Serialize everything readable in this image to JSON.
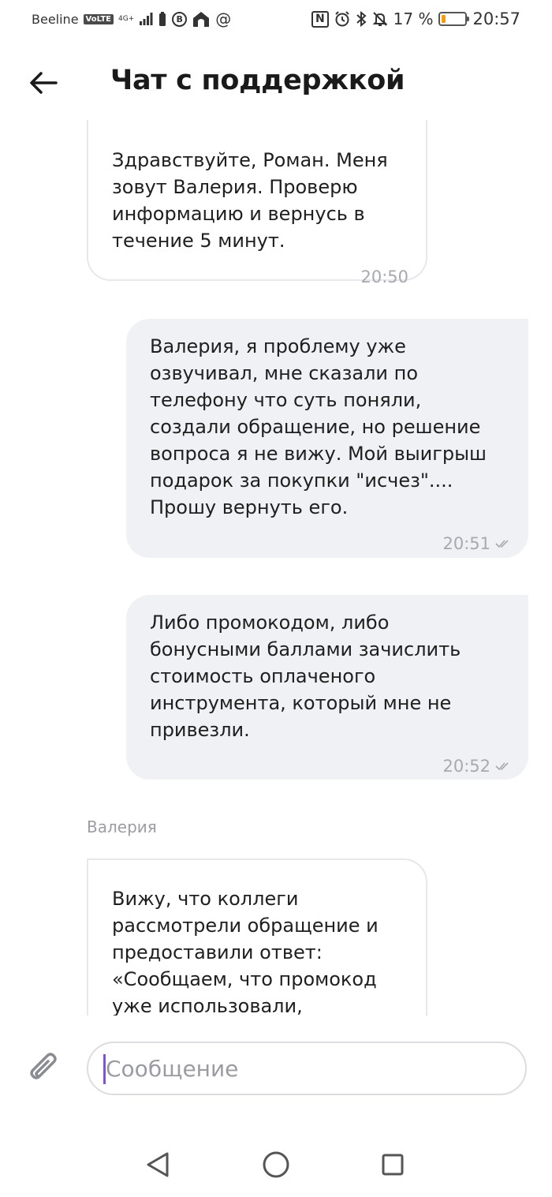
{
  "status_bar": {
    "carrier": "Beeline",
    "volte": "VoLTE",
    "network": "4G+",
    "vk_badge": "В",
    "at_sign": "@",
    "nfc": "N",
    "battery_percent_text": "17 %",
    "battery_level": 0.17,
    "battery_color": "#f39c12",
    "time": "20:57"
  },
  "header": {
    "title": "Чат с поддержкой"
  },
  "messages": [
    {
      "direction": "incoming",
      "text": "Здравствуйте, Роман. Меня\nзовут Валерия. Проверю\nинформацию и вернусь в\nтечение 5 минут.",
      "time": "20:50"
    },
    {
      "direction": "outgoing",
      "text": "Валерия, я проблему уже\nозвучивал, мне сказали по\nтелефону что суть поняли,\nсоздали обращение, но решение\nвопроса я не вижу. Мой выигрыш\nподарок за покупки \"исчез\"....\nПрошу вернуть его.",
      "time": "20:51"
    },
    {
      "direction": "outgoing",
      "text": "Либо промокодом, либо\nбонусными баллами зачислить\nстоимость оплаченого\nинструмента, который мне не\nпривезли.",
      "time": "20:52"
    },
    {
      "direction": "incoming",
      "sender": "Валерия",
      "text": "Вижу, что коллеги\nрассмотрели обращение и\nпредоставили ответ:\n«Сообщаем, что промокод\nуже использовали,"
    }
  ],
  "composer": {
    "placeholder": "Сообщение"
  },
  "colors": {
    "outgoing_bubble": "#f0f1f4",
    "incoming_border": "#e8e8ec",
    "caret": "#7e57c2"
  }
}
